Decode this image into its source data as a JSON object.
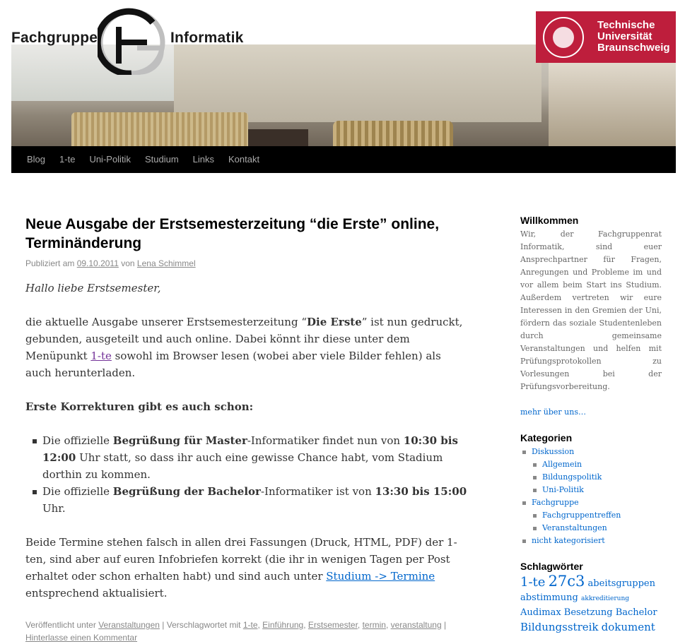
{
  "header": {
    "logo_word_left": "Fachgruppe",
    "logo_word_right": "Informatik",
    "tu_line1": "Technische",
    "tu_line2": "Universität",
    "tu_line3": "Braunschweig",
    "tu_seal_text": "CAROLO-WILHELMINA BRAUNSCHWEIG"
  },
  "nav": {
    "items": [
      "Blog",
      "1-te",
      "Uni-Politik",
      "Studium",
      "Links",
      "Kontakt"
    ]
  },
  "post": {
    "title": "Neue Ausgabe der Erstsemesterzeitung “die Erste” online, Terminänderung",
    "meta": {
      "published_prefix": "Publiziert am",
      "date": "09.10.2011",
      "by": "von",
      "author": "Lena Schimmel"
    },
    "greeting": "Hallo liebe Erstsemester,",
    "p1": {
      "a": "die aktuelle Ausgabe unserer Erstsemesterzeitung “",
      "bold": "Die Erste",
      "b": "” ist nun gedruckt, gebunden, ausgeteilt und auch online. Dabei könnt ihr diese unter dem Menüpunkt ",
      "link": "1-te",
      "c": " sowohl im Browser lesen (wobei aber viele Bilder fehlen) als auch herunterladen."
    },
    "corrections_heading": "Erste Korrekturen gibt es auch schon:",
    "list": [
      {
        "a": "Die offizielle ",
        "bold1": "Begrüßung für Master",
        "b": "-Informatiker findet nun von ",
        "bold2": "10:30 bis 12:00",
        "c": " Uhr statt, so dass ihr auch eine gewisse Chance habt, vom Stadium dorthin zu kommen."
      },
      {
        "a": "Die offizielle ",
        "bold1": "Begrüßung der Bachelor",
        "b": "-Informatiker ist von ",
        "bold2": "13:30 bis 15:00",
        "c": " Uhr."
      }
    ],
    "p3": {
      "a": "Beide Termine stehen falsch in allen drei Fassungen (Druck, HTML, PDF) der 1-ten, sind aber auf euren Infobriefen korrekt (die ihr in wenigen Tagen per Post erhaltet oder schon erhalten habt) und sind auch unter ",
      "link": "Studium -> Termine",
      "b": " entsprechend aktualisiert."
    },
    "utility": {
      "published_in": "Veröffentlicht unter",
      "category": "Veranstaltungen",
      "sep": "|",
      "tagged": "Verschlagwortet mit",
      "tags": [
        "1-te",
        "Einführung",
        "Erstsemester",
        "termin",
        "veranstaltung"
      ],
      "comment": "Hinterlasse einen Kommentar"
    }
  },
  "sidebar": {
    "welcome_title": "Willkommen",
    "welcome_text": "Wir, der Fachgruppenrat Informatik, sind euer Ansprechpartner für Fragen, Anregungen und Probleme im und vor allem beim Start ins Studium. Außerdem vertreten wir eure Interessen in den Gremien der Uni, fördern das soziale Studentenleben durch gemeinsame Veranstaltungen und helfen mit Prüfungsprotokollen zu Vorlesungen bei der Prüfungsvorbereitung.",
    "more_link": "mehr über uns…",
    "categories_title": "Kategorien",
    "categories": [
      {
        "label": "Diskussion",
        "sub": false
      },
      {
        "label": "Allgemein",
        "sub": true
      },
      {
        "label": "Bildungspolitik",
        "sub": true
      },
      {
        "label": "Uni-Politik",
        "sub": true
      },
      {
        "label": "Fachgruppe",
        "sub": false
      },
      {
        "label": "Fachgruppentreffen",
        "sub": true
      },
      {
        "label": "Veranstaltungen",
        "sub": true
      },
      {
        "label": "nicht kategorisiert",
        "sub": false
      }
    ],
    "tags_title": "Schlagwörter",
    "tags": [
      {
        "label": "1-te",
        "size": "large"
      },
      {
        "label": "27c3",
        "size": "xlarge"
      },
      {
        "label": "abeitsgruppen",
        "size": "medium"
      },
      {
        "label": "abstimmung",
        "size": "medium"
      },
      {
        "label": "akkreditierung",
        "size": "small"
      },
      {
        "label": "Audimax",
        "size": "medium"
      },
      {
        "label": "Besetzung",
        "size": "medium"
      },
      {
        "label": "Bachelor",
        "size": "medium"
      },
      {
        "label": "Bildungsstreik",
        "size": "large"
      },
      {
        "label": "dokument",
        "size": "large"
      }
    ]
  }
}
